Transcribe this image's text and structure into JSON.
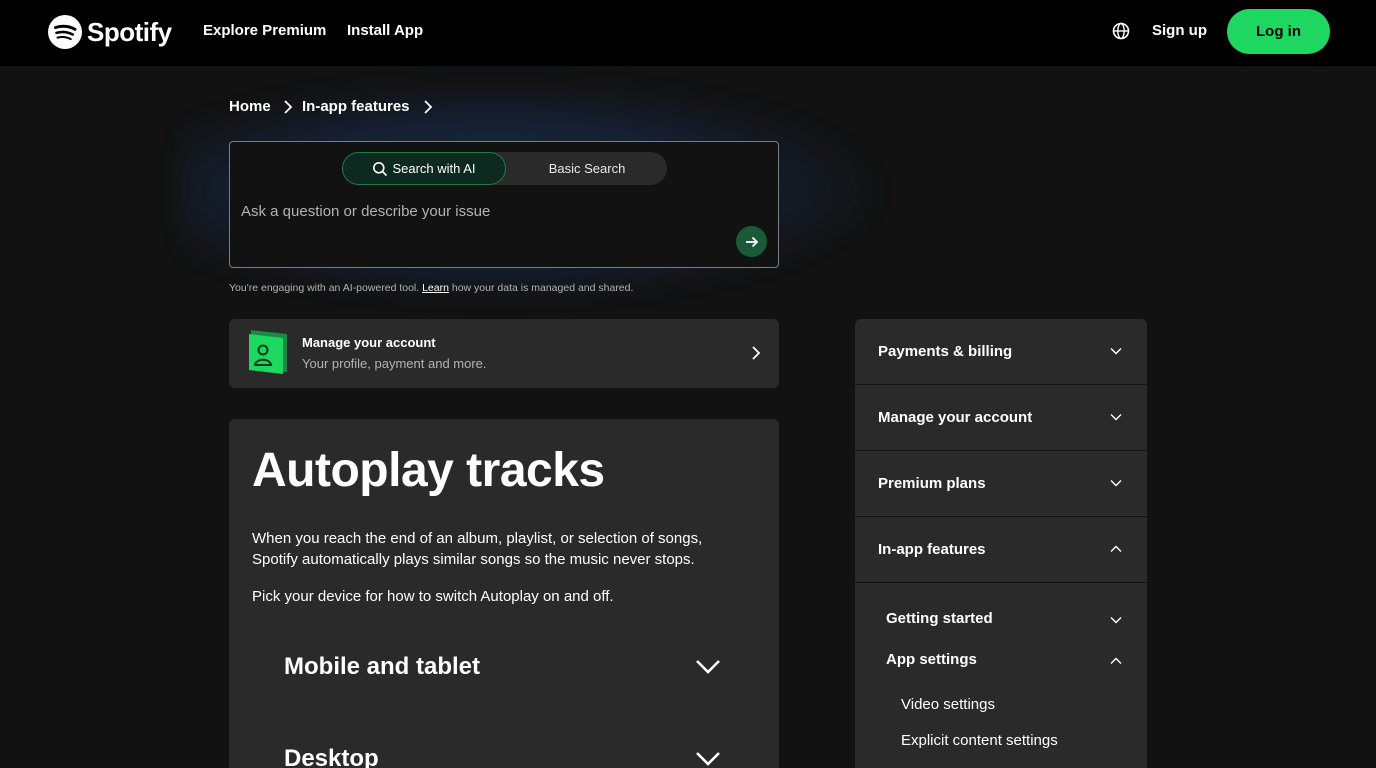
{
  "header": {
    "brand": "Spotify",
    "nav": [
      "Explore Premium",
      "Install App"
    ],
    "signup": "Sign up",
    "login": "Log in"
  },
  "breadcrumb": [
    "Home",
    "In-app features"
  ],
  "search": {
    "tab_ai": "Search with AI",
    "tab_basic": "Basic Search",
    "placeholder": "Ask a question or describe your issue",
    "disclaimer_before": "You're engaging with an AI-powered tool. ",
    "disclaimer_link": "Learn",
    "disclaimer_after": " how your data is managed and shared."
  },
  "account_card": {
    "title": "Manage your account",
    "subtitle": "Your profile, payment and more."
  },
  "article": {
    "title": "Autoplay tracks",
    "intro": "When you reach the end of an album, playlist, or selection of songs, Spotify automatically plays similar songs so the music never stops.",
    "instruction": "Pick your device for how to switch Autoplay on and off.",
    "devices": [
      "Mobile and tablet",
      "Desktop"
    ]
  },
  "sidebar": {
    "sections": [
      {
        "label": "Payments & billing",
        "expanded": false
      },
      {
        "label": "Manage your account",
        "expanded": false
      },
      {
        "label": "Premium plans",
        "expanded": false
      },
      {
        "label": "In-app features",
        "expanded": true
      }
    ],
    "subsections": [
      {
        "label": "Getting started",
        "expanded": false
      },
      {
        "label": "App settings",
        "expanded": true
      }
    ],
    "leaves": [
      "Video settings",
      "Explicit content settings"
    ]
  },
  "colors": {
    "accent": "#1ed760",
    "background": "#121212",
    "card": "#2a2a2a"
  }
}
